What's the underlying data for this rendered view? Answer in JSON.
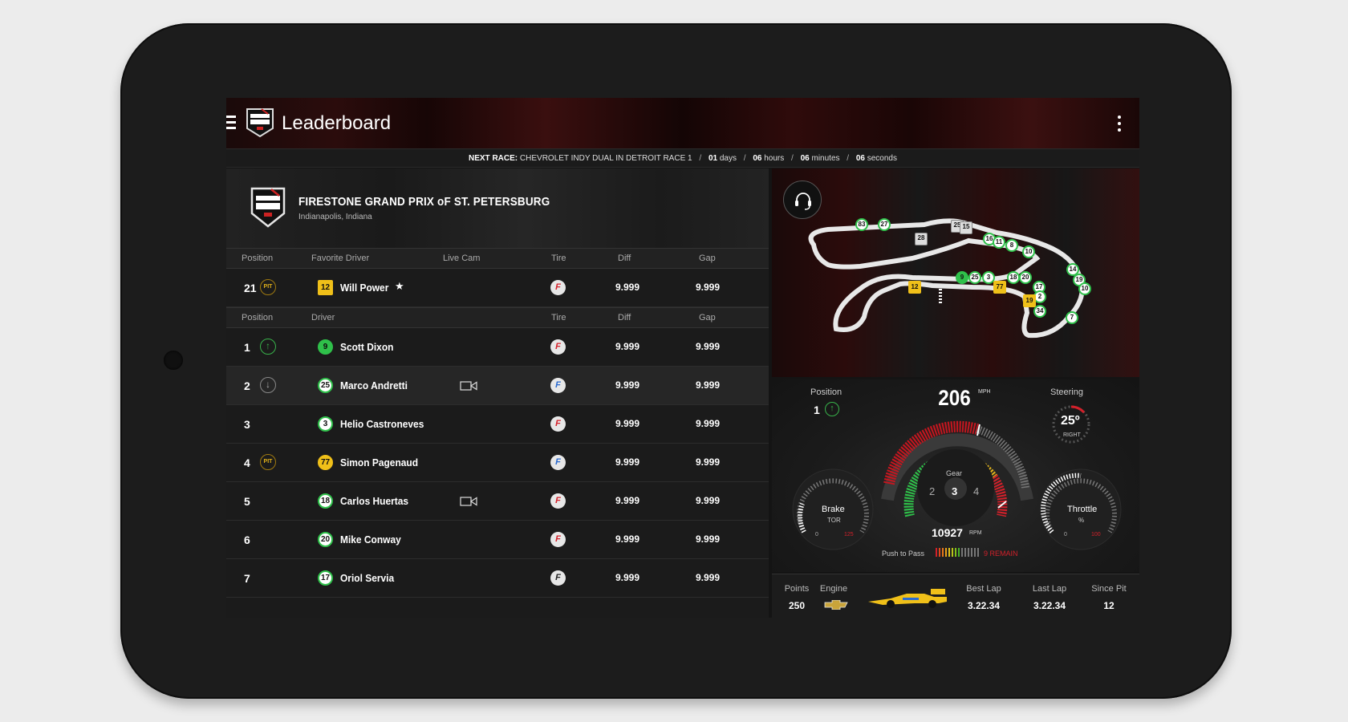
{
  "app": {
    "title": "Leaderboard"
  },
  "countdown": {
    "label": "NEXT RACE:",
    "race": "CHEVROLET INDY DUAL IN DETROIT RACE 1",
    "days_val": "01",
    "days_unit": "days",
    "hours_val": "06",
    "hours_unit": "hours",
    "minutes_val": "06",
    "minutes_unit": "minutes",
    "seconds_val": "06",
    "seconds_unit": "seconds"
  },
  "race": {
    "title": "FIRESTONE GRAND PRIX oF ST. PETERSBURG",
    "location": "Indianapolis, Indiana"
  },
  "favorite_header": {
    "position": "Position",
    "driver": "Favorite Driver",
    "live_cam": "Live Cam",
    "tire": "Tire",
    "diff": "Diff",
    "gap": "Gap"
  },
  "favorite": {
    "position": "21",
    "status": "PIT",
    "car": "12",
    "driver": "Will Power",
    "star": "★",
    "diff": "9.999",
    "gap": "9.999"
  },
  "drivers_header": {
    "position": "Position",
    "driver": "Driver",
    "tire": "Tire",
    "diff": "Diff",
    "gap": "Gap"
  },
  "drivers": [
    {
      "position": "1",
      "status": "↑",
      "car": "9",
      "name": "Scott Dixon",
      "tire": "F",
      "diff": "9.999",
      "gap": "9.999"
    },
    {
      "position": "2",
      "status": "↓",
      "car": "25",
      "name": "Marco Andretti",
      "tire": "F",
      "diff": "9.999",
      "gap": "9.999"
    },
    {
      "position": "3",
      "status": "",
      "car": "3",
      "name": "Helio Castroneves",
      "tire": "F",
      "diff": "9.999",
      "gap": "9.999"
    },
    {
      "position": "4",
      "status": "PIT",
      "car": "77",
      "name": "Simon Pagenaud",
      "tire": "F",
      "diff": "9.999",
      "gap": "9.999"
    },
    {
      "position": "5",
      "status": "",
      "car": "18",
      "name": "Carlos Huertas",
      "tire": "F",
      "diff": "9.999",
      "gap": "9.999"
    },
    {
      "position": "6",
      "status": "",
      "car": "20",
      "name": "Mike Conway",
      "tire": "F",
      "diff": "9.999",
      "gap": "9.999"
    },
    {
      "position": "7",
      "status": "",
      "car": "17",
      "name": "Oriol Servia",
      "tire": "F",
      "diff": "9.999",
      "gap": "9.999"
    }
  ],
  "track_markers": [
    "83",
    "27",
    "28",
    "25",
    "15",
    "16",
    "11",
    "8",
    "10",
    "14",
    "19",
    "10",
    "9",
    "25",
    "3",
    "77",
    "18",
    "20",
    "17",
    "2",
    "19",
    "34",
    "7",
    "12"
  ],
  "telemetry": {
    "position_label": "Position",
    "position_value": "1",
    "position_arrow": "↑",
    "speed": "206",
    "speed_unit": "MPH",
    "steering_label": "Steering",
    "steering_value": "25º",
    "steering_dir": "RIGHT",
    "brake_label": "Brake",
    "brake_unit": "TOR",
    "brake_min": "0",
    "brake_max": "125",
    "throttle_label": "Throttle",
    "throttle_unit": "%",
    "throttle_min": "0",
    "throttle_max": "100",
    "gear_label": "Gear",
    "gear_prev": "2",
    "gear": "3",
    "gear_next": "4",
    "rpm": "10927",
    "rpm_unit": "RPM",
    "push_to_pass_label": "Push to Pass",
    "push_to_pass_remain": "9 REMAIN"
  },
  "stats": {
    "points_label": "Points",
    "points": "250",
    "engine_label": "Engine",
    "best_lap_label": "Best Lap",
    "best_lap": "3.22.34",
    "last_lap_label": "Last Lap",
    "last_lap": "3.22.34",
    "since_pit_label": "Since Pit",
    "since_pit": "12"
  },
  "colors": {
    "accent_green": "#2fc04a",
    "accent_yellow": "#f0c019",
    "tire_red": "#d3202a",
    "tire_blue": "#2a6ad0",
    "push_red": "#d3202a"
  },
  "icons": [
    "menu-icon",
    "indycar-logo",
    "overflow-menu-icon",
    "headset-icon",
    "camera-icon",
    "star-icon",
    "chevrolet-logo",
    "race-car-image"
  ]
}
